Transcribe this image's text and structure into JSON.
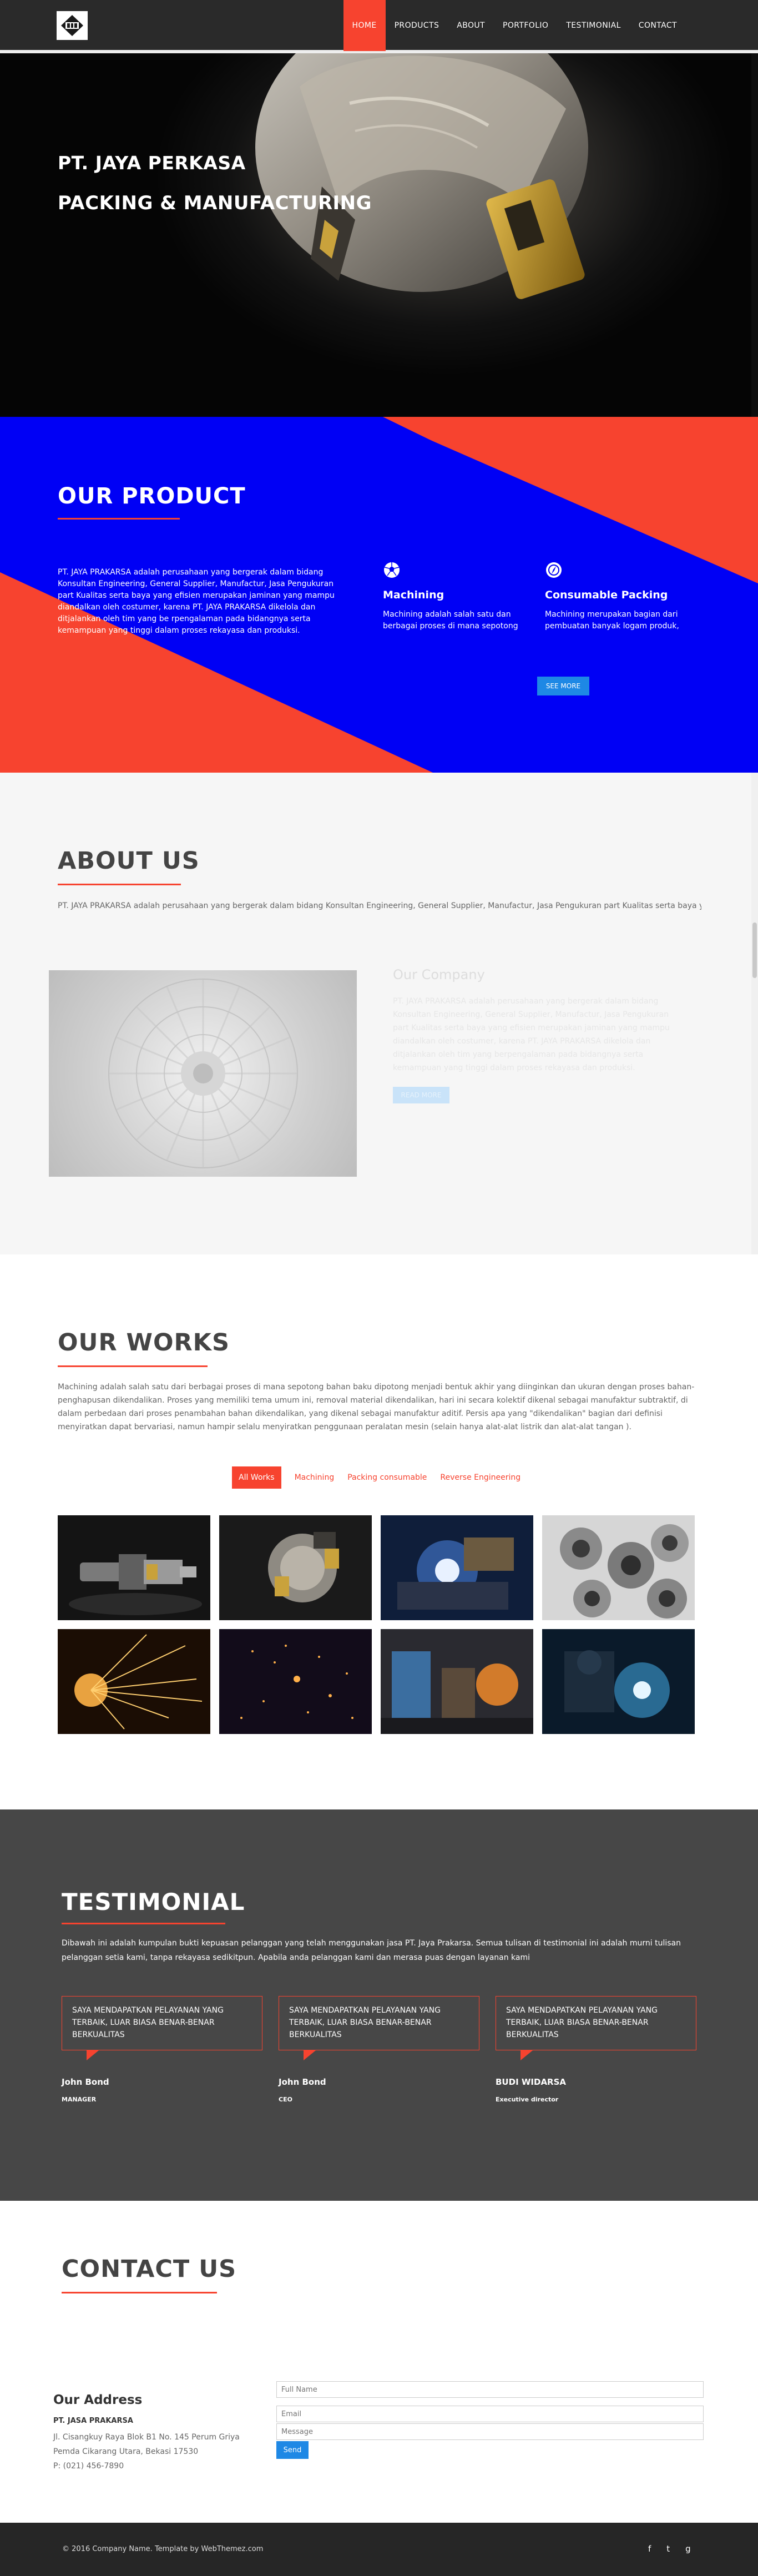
{
  "nav": {
    "items": [
      "HOME",
      "PRODUCTS",
      "ABOUT",
      "PORTFOLIO",
      "TESTIMONIAL",
      "CONTACT"
    ],
    "active": "HOME"
  },
  "hero": {
    "title": "PT. JAYA PERKASA",
    "subtitle": "PACKING & MANUFACTURING"
  },
  "product": {
    "title": "OUR PRODUCT",
    "description": "PT. JAYA PRAKARSA adalah perusahaan yang bergerak dalam bidang Konsultan Engineering, General Supplier, Manufactur, Jasa Pengukuran part Kualitas serta baya yang efisien merupakan jaminan yang mampu diandalkan oleh costumer, karena PT. JAYA PRAKARSA dikelola dan ditjalankan oleh tim yang be rpengalaman pada bidangnya serta kemampuan yang tinggi dalam proses rekayasa dan produksi.",
    "items": [
      {
        "icon": "soccer-ball-icon",
        "name": "Machining",
        "text": "Machining adalah salah satu dan berbagai proses di mana sepotong"
      },
      {
        "icon": "compass-icon",
        "name": "Consumable Packing",
        "text": "Machining merupakan bagian dari pembuatan banyak logam produk,"
      }
    ],
    "button": "SEE MORE"
  },
  "about": {
    "title": "ABOUT US",
    "intro": "PT. JAYA PRAKARSA adalah perusahaan yang bergerak dalam bidang Konsultan Engineering, General Supplier, Manufactur, Jasa Pengukuran part Kualitas serta baya yang",
    "company_title": "Our Company",
    "company_text": "PT. JAYA PRAKARSA adalah perusahaan yang bergerak dalam bidang Konsultan Engineering, General Supplier, Manufactur, Jasa Pengukuran part Kualitas serta baya yang efisien merupakan jaminan yang mampu diandalkan oleh costumer, karena PT. JAYA PRAKARSA dikelola dan ditjalankan oleh tim yang berpengalaman pada bidangnya serta kemampuan yang tinggi dalam proses rekayasa dan produksi.",
    "company_button": "READ MORE"
  },
  "works": {
    "title": "OUR WORKS",
    "description": "Machining adalah salah satu dari berbagai proses di mana sepotong bahan baku dipotong menjadi bentuk akhir yang diinginkan dan ukuran dengan proses bahan-penghapusan dikendalikan. Proses yang memiliki tema umum ini, removal material dikendalikan, hari ini secara kolektif dikenal sebagai manufaktur subtraktif, di dalam perbedaan dari proses penambahan bahan dikendalikan, yang dikenal sebagai manufaktur aditif. Persis apa yang \"dikendalikan\" bagian dari definisi menyiratkan dapat bervariasi, namun hampir selalu menyiratkan penggunaan peralatan mesin (selain hanya alat-alat listrik dan alat-alat tangan ).",
    "filters": [
      "All Works",
      "Machining",
      "Packing consumable",
      "Reverse Engineering"
    ],
    "active_filter": "All Works",
    "tiles": [
      "tool-holder-photo",
      "milling-cutter-photo",
      "welding-photo",
      "rollers-photo",
      "grinding-sparks-photo",
      "sparks-photo",
      "factory-photo",
      "welder-photo"
    ]
  },
  "testimonial": {
    "title": "TESTIMONIAL",
    "description": "Dibawah ini adalah kumpulan bukti kepuasan pelanggan yang telah menggunakan jasa PT. Jaya Prakarsa. Semua tulisan di testimonial ini adalah murni tulisan pelanggan setia kami, tanpa rekayasa sedikitpun. Apabila anda pelanggan kami dan merasa puas dengan layanan kami",
    "items": [
      {
        "quote": "SAYA MENDAPATKAN PELAYANAN YANG TERBAIK, LUAR BIASA BENAR-BENAR BERKUALITAS",
        "name": "John Bond",
        "role": "MANAGER"
      },
      {
        "quote": "SAYA MENDAPATKAN PELAYANAN YANG TERBAIK, LUAR BIASA BENAR-BENAR BERKUALITAS",
        "name": "John Bond",
        "role": "CEO"
      },
      {
        "quote": "SAYA MENDAPATKAN PELAYANAN YANG TERBAIK, LUAR BIASA BENAR-BENAR BERKUALITAS",
        "name": "BUDI WIDARSA",
        "role": "Executive director"
      }
    ]
  },
  "contact": {
    "title": "CONTACT US",
    "address_title": "Our Address",
    "company": "PT. JASA PRAKARSA",
    "address_lines": [
      "Jl. Cisangkuy Raya Blok B1 No. 145 Perum Griya",
      "Pemda Cikarang Utara, Bekasi 17530",
      "P: (021) 456-7890"
    ],
    "placeholders": {
      "name": "Full Name",
      "email": "Email",
      "message": "Message"
    },
    "send": "Send"
  },
  "footer": {
    "copyright": "© 2016 Company Name. Template by WebThemez.com",
    "socials": [
      "f",
      "t",
      "g"
    ]
  },
  "colors": {
    "accent": "#f7432f",
    "blue": "#0000f5",
    "button_blue": "#1e88e5",
    "dark": "#474747"
  }
}
